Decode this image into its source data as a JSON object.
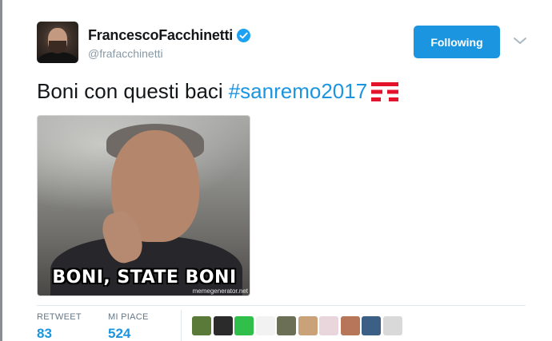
{
  "author": {
    "display_name": "FrancescoFacchinetti",
    "handle": "@frafacchinetti",
    "verified": true
  },
  "follow_button": {
    "label": "Following",
    "color": "#1b95e0"
  },
  "menu_icon": "chevron-down-icon",
  "tweet": {
    "text": "Boni con questi baci",
    "hashtag": "#sanremo2017",
    "emoji": "tim-logo-emoji"
  },
  "media": {
    "caption": "BONI, STATE BONI",
    "watermark": "memegenerator.net"
  },
  "stats": {
    "retweets_label": "RETWEET",
    "retweets_value": "83",
    "likes_label": "MI PIACE",
    "likes_value": "524"
  },
  "likers": [
    {
      "name": "liker-avatar-1",
      "color": "#5a7a3a"
    },
    {
      "name": "liker-avatar-2",
      "color": "#2b2b2b"
    },
    {
      "name": "liker-avatar-3",
      "color": "#2fbf4a"
    },
    {
      "name": "liker-avatar-4",
      "color": "#f2f2f2"
    },
    {
      "name": "liker-avatar-5",
      "color": "#6b6f55"
    },
    {
      "name": "liker-avatar-6",
      "color": "#c9a27a"
    },
    {
      "name": "liker-avatar-7",
      "color": "#e9d5dc"
    },
    {
      "name": "liker-avatar-8",
      "color": "#b7755a"
    },
    {
      "name": "liker-avatar-9",
      "color": "#3c5f86"
    },
    {
      "name": "liker-avatar-10",
      "color": "#d9d9d9"
    }
  ],
  "colors": {
    "text": "#14171a",
    "secondary": "#8899a6",
    "link": "#1b95e0",
    "tim_red": "#e3132c"
  }
}
